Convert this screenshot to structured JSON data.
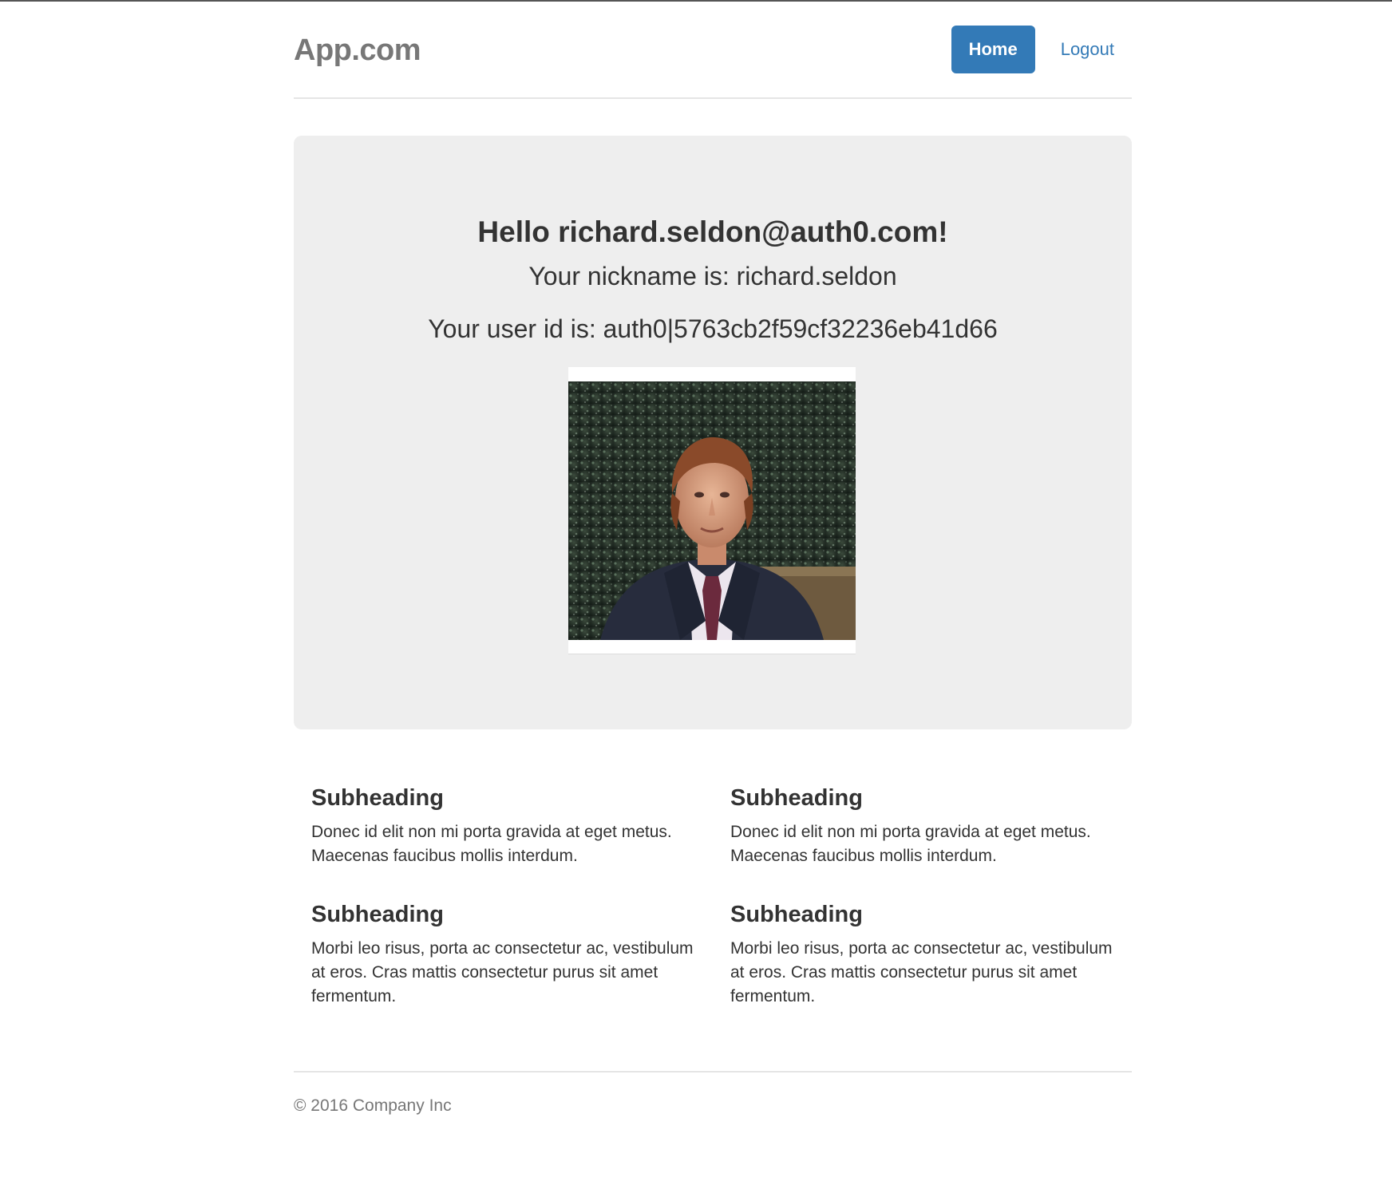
{
  "header": {
    "brand": "App.com",
    "nav": [
      {
        "label": "Home",
        "active": true
      },
      {
        "label": "Logout",
        "active": false
      }
    ]
  },
  "jumbotron": {
    "greeting": "Hello richard.seldon@auth0.com!",
    "nickname_line": "Your nickname is: richard.seldon",
    "user_id_line": "Your user id is: auth0|5763cb2f59cf32236eb41d66"
  },
  "marketing": {
    "columns": [
      {
        "heading": "Subheading",
        "text": "Donec id elit non mi porta gravida at eget metus. Maecenas faucibus mollis interdum."
      },
      {
        "heading": "Subheading",
        "text": "Morbi leo risus, porta ac consectetur ac, vestibulum at eros. Cras mattis consectetur purus sit amet fermentum."
      },
      {
        "heading": "Subheading",
        "text": "Donec id elit non mi porta gravida at eget metus. Maecenas faucibus mollis interdum."
      },
      {
        "heading": "Subheading",
        "text": "Morbi leo risus, porta ac consectetur ac, vestibulum at eros. Cras mattis consectetur purus sit amet fermentum."
      }
    ]
  },
  "footer": {
    "text": "© 2016 Company Inc"
  },
  "colors": {
    "primary": "#337ab7",
    "jumbotron_bg": "#eeeeee",
    "muted": "#777777"
  }
}
